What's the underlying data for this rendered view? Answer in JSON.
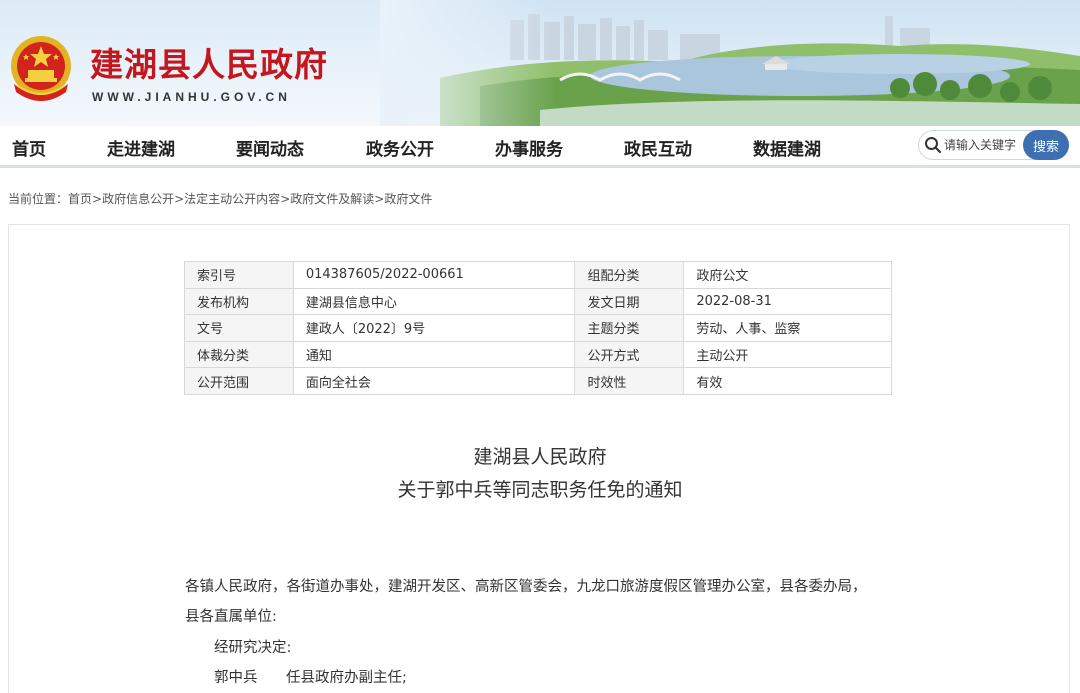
{
  "header": {
    "site_title": "建湖县人民政府",
    "site_url": "WWW.JIANHU.GOV.CN",
    "emblem_icon": "national-emblem-icon",
    "accent_color": "#c4161c"
  },
  "nav": {
    "items": [
      "首页",
      "走进建湖",
      "要闻动态",
      "政务公开",
      "办事服务",
      "政民互动",
      "数据建湖"
    ]
  },
  "search": {
    "placeholder": "请输入关键字",
    "button_label": "搜索",
    "button_color": "#3d6fb2"
  },
  "breadcrumb": {
    "prefix": "当前位置：",
    "items": [
      "首页",
      "政府信息公开",
      "法定主动公开内容",
      "政府文件及解读",
      "政府文件"
    ],
    "separator": ">"
  },
  "meta_table": {
    "rows": [
      [
        "索引号",
        "014387605/2022-00661",
        "组配分类",
        "政府公文"
      ],
      [
        "发布机构",
        "建湖县信息中心",
        "发文日期",
        "2022-08-31"
      ],
      [
        "文号",
        "建政人〔2022〕9号",
        "主题分类",
        "劳动、人事、监察"
      ],
      [
        "体裁分类",
        "通知",
        "公开方式",
        "主动公开"
      ],
      [
        "公开范围",
        "面向全社会",
        "时效性",
        "有效"
      ]
    ]
  },
  "document": {
    "title_line1": "建湖县人民政府",
    "title_line2": "关于郭中兵等同志职务任免的通知",
    "recipients_line1": "各镇人民政府，各街道办事处，建湖开发区、高新区管委会，九龙口旅游度假区管理办公室，县各委办局，",
    "recipients_line2": "县各直属单位:",
    "decision": "经研究决定:",
    "appointment_name": "郭中兵",
    "appointment_role": "任县政府办副主任;"
  }
}
